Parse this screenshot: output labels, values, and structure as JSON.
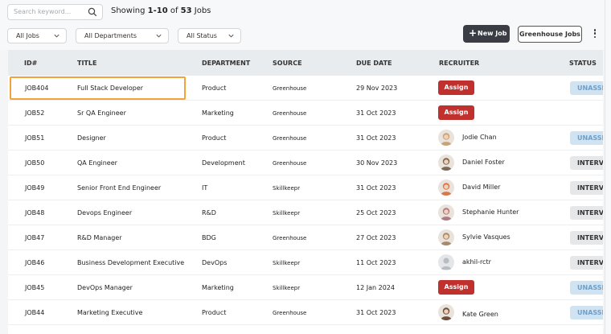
{
  "search": {
    "placeholder": "Search keyword..."
  },
  "summary": {
    "prefix": "Showing ",
    "range": "1-10",
    "mid": " of ",
    "total": "53",
    "suffix": " Jobs"
  },
  "filters": [
    {
      "label": "All Jobs"
    },
    {
      "label": "All Departments"
    },
    {
      "label": "All Status"
    }
  ],
  "actions": {
    "new_job": "New Job",
    "greenhouse": "Greenhouse Jobs"
  },
  "table": {
    "headers": {
      "id": "ID#",
      "title": "TITLE",
      "department": "DEPARTMENT",
      "source": "SOURCE",
      "due": "DUE DATE",
      "recruiter": "RECRUITER",
      "status": "STATUS"
    },
    "assign_label": "Assign",
    "rows": [
      {
        "id": "JOB404",
        "title": "Full Stack Developer",
        "department": "Product",
        "source": "Greenhouse",
        "due": "29 Nov 2023",
        "recruiter": "",
        "status": "UNASSIGNED",
        "status_kind": "un",
        "avatar_color": ""
      },
      {
        "id": "JOB52",
        "title": "Sr QA Engineer",
        "department": "Marketing",
        "source": "Greenhouse",
        "due": "31 Oct 2023",
        "recruiter": "",
        "status": "",
        "status_kind": "",
        "avatar_color": ""
      },
      {
        "id": "JOB51",
        "title": "Designer",
        "department": "Product",
        "source": "Greenhouse",
        "due": "31 Oct 2023",
        "recruiter": "Jodie Chan",
        "status": "UNASSIGNED",
        "status_kind": "un",
        "avatar_color": "#c9a27a"
      },
      {
        "id": "JOB50",
        "title": "QA Engineer",
        "department": "Development",
        "source": "Greenhouse",
        "due": "30 Nov 2023",
        "recruiter": "Daniel Foster",
        "status": "INTERVIEWING",
        "status_kind": "iv",
        "avatar_color": "#7b6a55"
      },
      {
        "id": "JOB49",
        "title": "Senior Front End Engineer",
        "department": "IT",
        "source": "Skillkeepr",
        "due": "31 Oct 2023",
        "recruiter": "David Miller",
        "status": "INTERVIEWING",
        "status_kind": "iv",
        "avatar_color": "#d9774a"
      },
      {
        "id": "JOB48",
        "title": "Devops Engineer",
        "department": "R&D",
        "source": "Skillkeepr",
        "due": "25 Oct 2023",
        "recruiter": "Stephanie Hunter",
        "status": "INTERVIEWING",
        "status_kind": "iv",
        "avatar_color": "#b07a86"
      },
      {
        "id": "JOB47",
        "title": "R&D Manager",
        "department": "BDG",
        "source": "Greenhouse",
        "due": "27 Oct 2023",
        "recruiter": "Sylvie Vasques",
        "status": "INTERVIEWING",
        "status_kind": "iv",
        "avatar_color": "#a58a6e"
      },
      {
        "id": "JOB46",
        "title": "Business Development Executive",
        "department": "DevOps",
        "source": "Skillkeepr",
        "due": "11 Oct 2023",
        "recruiter": "akhil-rctr",
        "status": "INTERVIEWING",
        "status_kind": "iv",
        "avatar_color": "#d6d8db"
      },
      {
        "id": "JOB45",
        "title": "DevOps Manager",
        "department": "Marketing",
        "source": "Skillkeepr",
        "due": "12 Jan 2024",
        "recruiter": "",
        "status": "UNASSIGNED",
        "status_kind": "un",
        "avatar_color": ""
      },
      {
        "id": "JOB44",
        "title": "Marketing Executive",
        "department": "Product",
        "source": "Greenhouse",
        "due": "31 Oct 2023",
        "recruiter": "Kate Green",
        "status": "UNASSIGNED",
        "status_kind": "un",
        "avatar_color": "#6b4f3f"
      }
    ]
  },
  "colors": {
    "assign": "#c0302d",
    "primary_button": "#3a3e44",
    "highlight": "#f2a33a",
    "status_unassigned": "#cfe3f3",
    "status_interviewing": "#e6e7e9"
  }
}
